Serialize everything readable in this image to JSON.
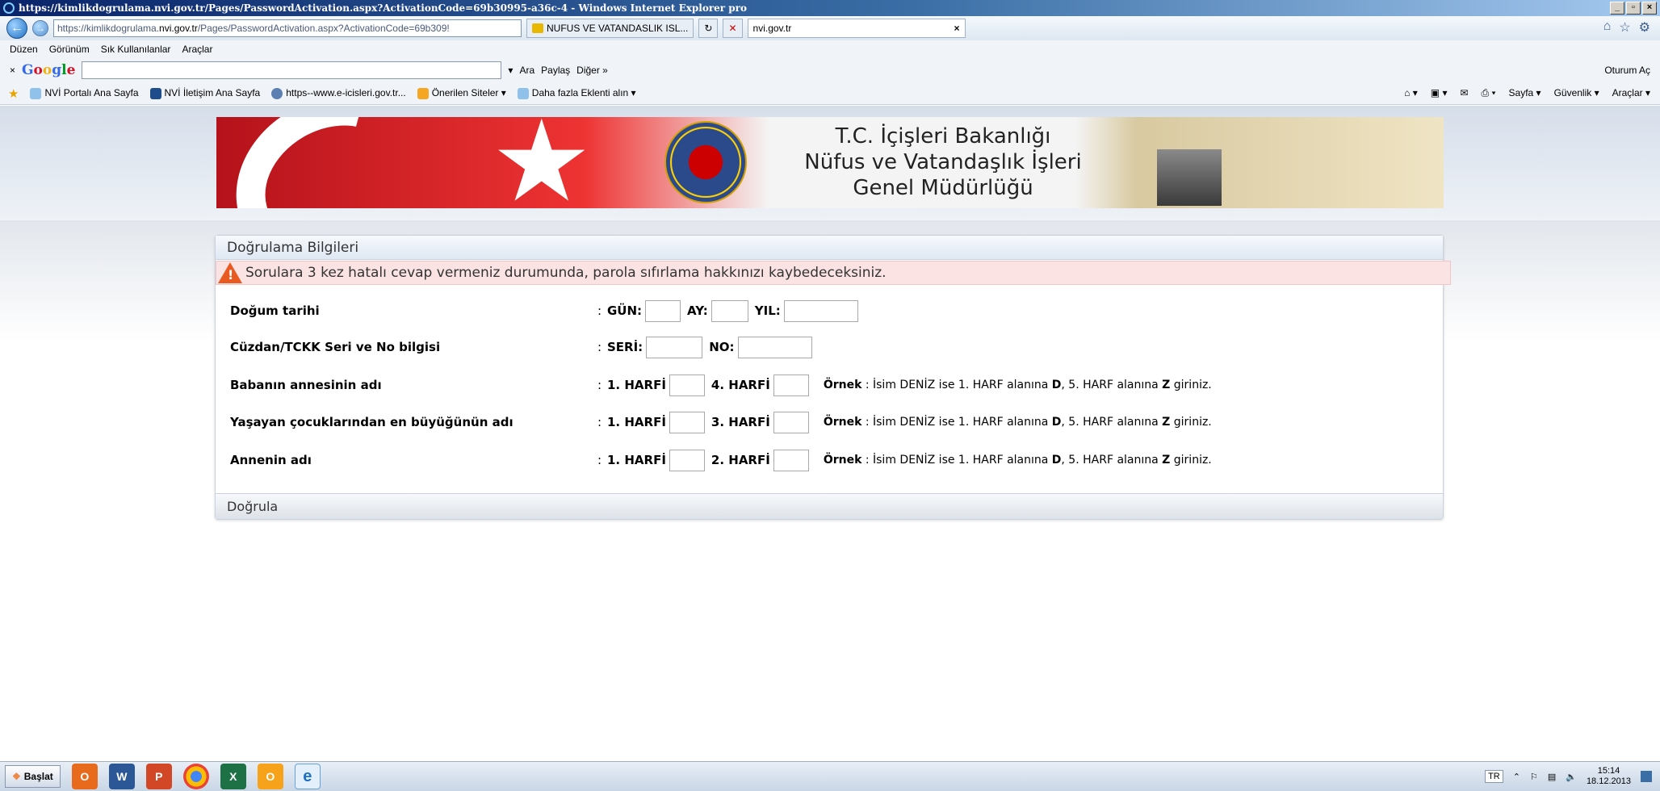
{
  "browser": {
    "title": "https://kimlikdogrulama.nvi.gov.tr/Pages/PasswordActivation.aspx?ActivationCode=69b30995-a36c-4 - Windows Internet Explorer pro",
    "url_prefix": "https://kimlikdogrulama.",
    "url_domain": "nvi.gov.tr",
    "url_suffix": "/Pages/PasswordActivation.aspx?ActivationCode=69b309!",
    "tab1": "NUFUS VE VATANDASLIK ISL...",
    "tab2": "nvi.gov.tr",
    "menu": [
      "Düzen",
      "Görünüm",
      "Sık Kullanılanlar",
      "Araçlar"
    ],
    "google": {
      "logo": "Google",
      "ara": "Ara",
      "paylas": "Paylaş",
      "diger": "Diğer »",
      "oturum": "Oturum Aç"
    },
    "favorites": [
      "NVİ Portalı Ana Sayfa",
      "NVİ İletişim Ana Sayfa",
      "https--www.e-icisleri.gov.tr...",
      "Önerilen Siteler",
      "Daha fazla Eklenti alın"
    ],
    "favbar_right": [
      "Sayfa",
      "Güvenlik",
      "Araçlar"
    ]
  },
  "banner": {
    "line1": "T.C. İçişleri Bakanlığı",
    "line2": "Nüfus ve Vatandaşlık İşleri",
    "line3": "Genel Müdürlüğü"
  },
  "panel": {
    "title": "Doğrulama Bilgileri",
    "alert": "Sorulara 3 kez hatalı cevap vermeniz durumunda, parola sıfırlama hakkınızı kaybedeceksiniz.",
    "rows": [
      {
        "label": "Doğum tarihi",
        "f1": "GÜN:",
        "f2": "AY:",
        "f3": "YIL:"
      },
      {
        "label": "Cüzdan/TCKK Seri ve No bilgisi",
        "f1": "SERİ:",
        "f2": "NO:"
      },
      {
        "label": "Babanın annesinin adı",
        "f1": "1. HARFİ",
        "f2": "4. HARFİ"
      },
      {
        "label": "Yaşayan çocuklarından en büyüğünün adı",
        "f1": "1. HARFİ",
        "f2": "3. HARFİ"
      },
      {
        "label": "Annenin adı",
        "f1": "1. HARFİ",
        "f2": "2. HARFİ"
      }
    ],
    "hint": {
      "ornek": "Örnek",
      "t1": " : İsim DENİZ ise 1. HARF alanına ",
      "d": "D",
      "t2": ", 5. HARF alanına ",
      "z": "Z",
      "t3": " giriniz."
    },
    "submit": "Doğrula"
  },
  "taskbar": {
    "start": "Başlat",
    "lang": "TR",
    "time": "15:14",
    "date": "18.12.2013"
  }
}
